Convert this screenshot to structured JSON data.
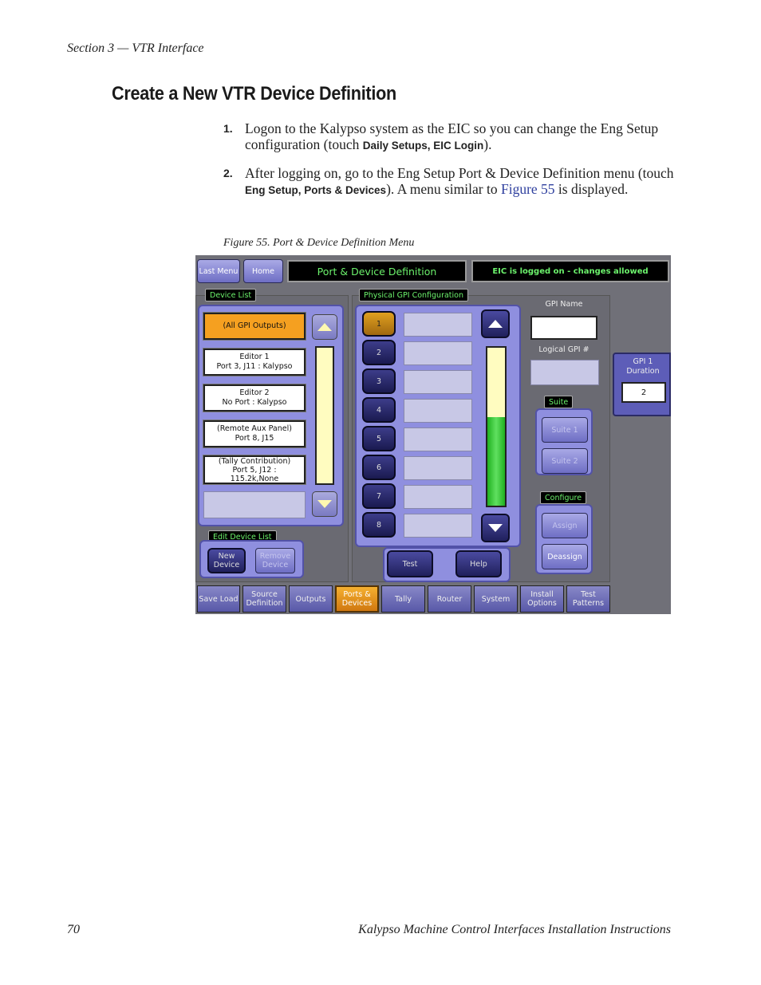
{
  "section_header": "Section 3 — VTR Interface",
  "title": "Create a New VTR Device Definition",
  "steps": [
    {
      "num": "1.",
      "text_a": "Logon to the Kalypso system as the EIC so you can change the Eng Setup configuration (touch ",
      "kw1": "Daily Setups",
      "sep": ", ",
      "kw2": "EIC Login",
      "text_b": ")."
    },
    {
      "num": "2.",
      "text_a": "After logging on, go to the Eng Setup Port & Device Definition menu (touch ",
      "kw1": "Eng Setup",
      "sep": ", ",
      "kw2": "Ports & Devices",
      "text_b": "). A menu similar to ",
      "link": "Figure 55",
      "text_c": " is displayed."
    }
  ],
  "figure_caption": "Figure 55.  Port & Device Definition Menu",
  "ui": {
    "last_menu": "Last Menu",
    "home": "Home",
    "menu_title": "Port & Device Definition",
    "status": "EIC is logged on - changes allowed",
    "device_list_label": "Device List",
    "devices": [
      {
        "line1": "(All GPI Outputs)",
        "line2": ""
      },
      {
        "line1": "Editor 1",
        "line2": "Port 3, J11 : Kalypso"
      },
      {
        "line1": "Editor 2",
        "line2": "No Port : Kalypso"
      },
      {
        "line1": "(Remote Aux Panel)",
        "line2": "Port 8, J15"
      },
      {
        "line1": "(Tally Contribution)",
        "line2": "Port 5, J12 :",
        "line3": "115.2k,None"
      }
    ],
    "edit_device_list_label": "Edit Device List",
    "new_device": "New Device",
    "remove_device": "Remove Device",
    "physical_gpi_label": "Physical GPI Configuration",
    "gpi_numbers": [
      "1",
      "2",
      "3",
      "4",
      "5",
      "6",
      "7",
      "8"
    ],
    "test": "Test",
    "help": "Help",
    "gpi_name_label": "GPI Name",
    "logical_gpi_label": "Logical GPI #",
    "gpi_duration_label": "GPI 1 Duration",
    "gpi_duration_value": "2",
    "suite_label": "Suite",
    "suite1": "Suite 1",
    "suite2": "Suite 2",
    "configure_label": "Configure",
    "assign": "Assign",
    "deassign": "Deassign",
    "tabs": [
      "Save Load",
      "Source Definition",
      "Outputs",
      "Ports & Devices",
      "Tally",
      "Router",
      "System",
      "Install Options",
      "Test Patterns"
    ],
    "scroll_level": 0.56,
    "colors": {
      "accent": "#f5a020",
      "green_text": "#6cf26c",
      "panel": "#8f8fdf"
    }
  },
  "footer": {
    "page_number": "70",
    "doc_title": "Kalypso Machine Control Interfaces Installation Instructions"
  }
}
